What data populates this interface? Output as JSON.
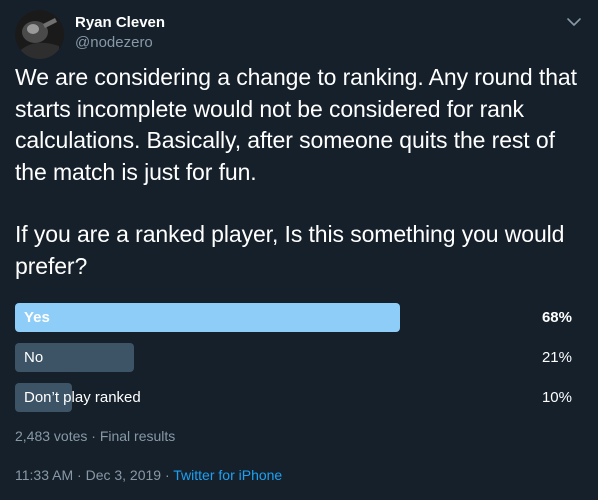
{
  "author": {
    "display_name": "Ryan Cleven",
    "handle": "@nodezero"
  },
  "tweet": {
    "paragraphs": [
      "We are considering a change to ranking. Any round that starts incomplete would not be considered for rank calculations. Basically, after someone quits the rest of the match is just for fun.",
      "If you are a ranked player, Is this something you would prefer?"
    ]
  },
  "poll": {
    "options": [
      {
        "label": "Yes",
        "percent_text": "68%",
        "percent": 68,
        "winner": true
      },
      {
        "label": "No",
        "percent_text": "21%",
        "percent": 21,
        "winner": false
      },
      {
        "label": "Don’t play ranked",
        "percent_text": "10%",
        "percent": 10,
        "winner": false
      }
    ],
    "meta": "2,483 votes · Final results"
  },
  "footer": {
    "time": "11:33 AM",
    "sep1": " · ",
    "date": "Dec 3, 2019",
    "sep2": " · ",
    "source": "Twitter for iPhone"
  },
  "colors": {
    "background": "#15202b",
    "winner_bar": "#8ecdf7",
    "bar": "#3d5466",
    "secondary_text": "#8899a6",
    "link": "#1da1f2"
  },
  "icons": {
    "menu": "chevron-down-icon"
  }
}
